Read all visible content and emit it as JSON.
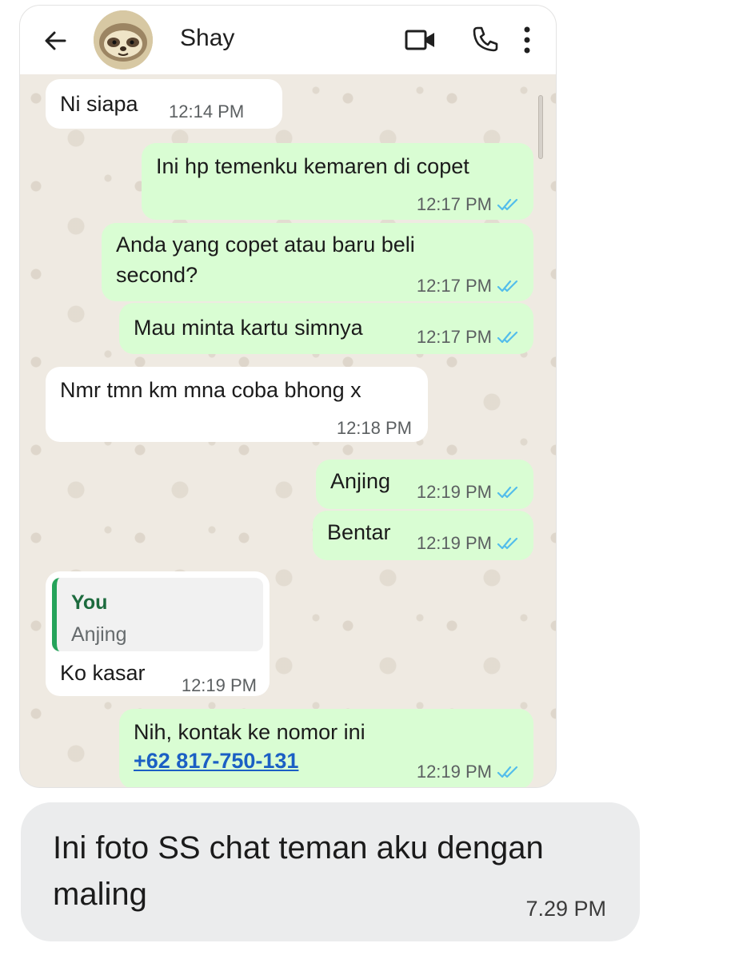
{
  "header": {
    "contact_name": "Shay",
    "back_icon": "arrow-left-icon",
    "video_icon": "video-camera-icon",
    "call_icon": "phone-icon",
    "menu_icon": "more-vertical-icon"
  },
  "messages": [
    {
      "direction": "in",
      "text": "Ni siapa",
      "time": "12:14 PM"
    },
    {
      "direction": "out",
      "text": "Ini hp temenku kemaren di copet",
      "time": "12:17 PM",
      "read": true
    },
    {
      "direction": "out",
      "text_line1": "Anda yang copet atau baru beli",
      "text_line2": "second?",
      "time": "12:17 PM",
      "read": true
    },
    {
      "direction": "out",
      "text": "Mau minta kartu simnya",
      "time": "12:17 PM",
      "read": true
    },
    {
      "direction": "in",
      "text": "Nmr tmn km mna coba bhong x",
      "time": "12:18 PM"
    },
    {
      "direction": "out",
      "text": "Anjing",
      "time": "12:19 PM",
      "read": true
    },
    {
      "direction": "out",
      "text": "Bentar",
      "time": "12:19 PM",
      "read": true
    },
    {
      "direction": "in",
      "quote_author": "You",
      "quote_text": "Anjing",
      "text": "Ko kasar",
      "time": "12:19 PM"
    },
    {
      "direction": "out",
      "text": "Nih, kontak ke nomor ini",
      "link": "+62 817-750-131",
      "time": "12:19 PM",
      "read": true
    }
  ],
  "outer_message": {
    "text": "Ini foto SS chat teman aku dengan maling",
    "time": "7.29 PM"
  },
  "colors": {
    "incoming_bubble": "#ffffff",
    "outgoing_bubble": "#d9fdd3",
    "chat_background": "#efeae2",
    "read_ticks": "#53bdeb",
    "link": "#1b5fc4",
    "quote_bar": "#25a35a"
  }
}
